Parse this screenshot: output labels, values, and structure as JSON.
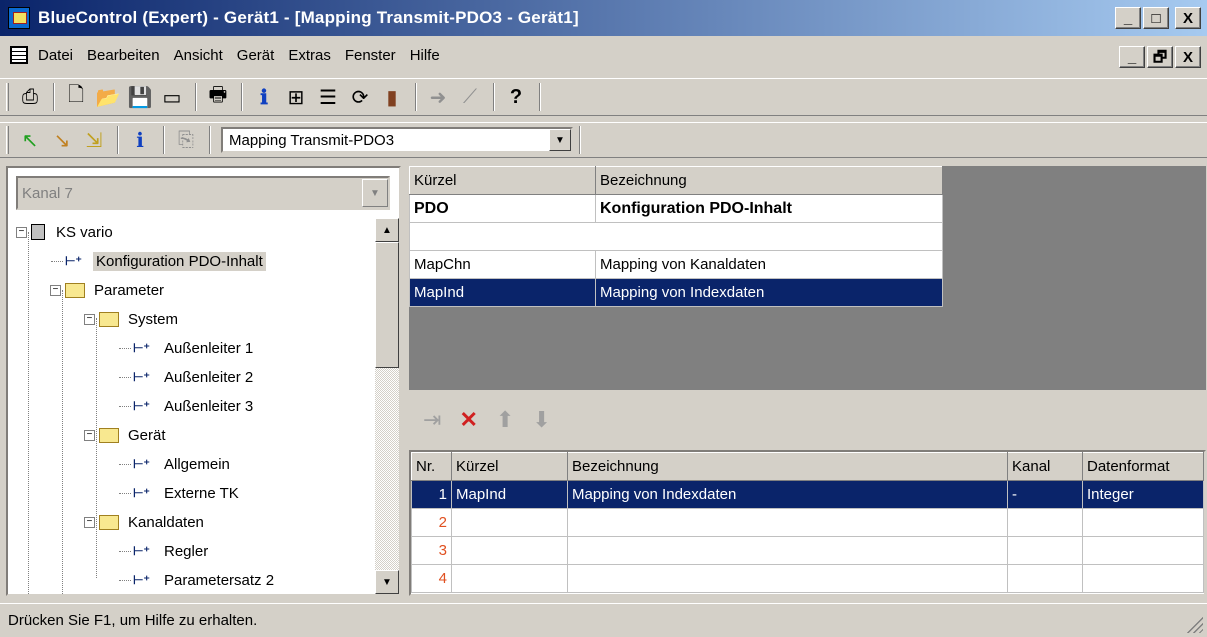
{
  "window": {
    "title": "BlueControl (Expert) - Gerät1 - [Mapping Transmit-PDO3 - Gerät1]",
    "buttons": [
      "_",
      "□",
      "X"
    ],
    "mdi_buttons": [
      "_",
      "🗗",
      "X"
    ]
  },
  "menu": {
    "items": [
      "Datei",
      "Bearbeiten",
      "Ansicht",
      "Gerät",
      "Extras",
      "Fenster",
      "Hilfe"
    ]
  },
  "toolbar1": {
    "icons": [
      "properties-icon",
      "new-icon",
      "open-icon",
      "save-icon",
      "window-icon",
      "print-icon",
      "info-icon",
      "tree-icon",
      "list-icon",
      "refresh-icon",
      "device-icon",
      "transfer-icon",
      "chart-icon",
      "help-icon"
    ],
    "glyphs": [
      "⎙",
      "🗋",
      "📂",
      "💾",
      "▭",
      "🖶",
      "ℹ",
      "⊞",
      "☰",
      "⟳",
      "▮",
      "➜",
      "⟋",
      "?"
    ]
  },
  "toolbar2": {
    "glyphs": [
      "↖",
      "↘",
      "⇲",
      "ℹ",
      "⎘"
    ],
    "combo_value": "Mapping Transmit-PDO3"
  },
  "left": {
    "kanal": "Kanal 7",
    "tree": [
      {
        "label": "KS vario",
        "type": "device",
        "level": 0,
        "expander": "−"
      },
      {
        "label": "Konfiguration PDO-Inhalt",
        "type": "param",
        "level": 1,
        "selected": true
      },
      {
        "label": "Parameter",
        "type": "folder",
        "level": 1,
        "expander": "−"
      },
      {
        "label": "System",
        "type": "folder",
        "level": 2,
        "expander": "−"
      },
      {
        "label": "Außenleiter 1",
        "type": "param",
        "level": 3
      },
      {
        "label": "Außenleiter 2",
        "type": "param",
        "level": 3
      },
      {
        "label": "Außenleiter 3",
        "type": "param",
        "level": 3
      },
      {
        "label": "Gerät",
        "type": "folder",
        "level": 2,
        "expander": "−"
      },
      {
        "label": "Allgemein",
        "type": "param",
        "level": 3
      },
      {
        "label": "Externe TK",
        "type": "param",
        "level": 3
      },
      {
        "label": "Kanaldaten",
        "type": "folder",
        "level": 2,
        "expander": "−"
      },
      {
        "label": "Regler",
        "type": "param",
        "level": 3
      },
      {
        "label": "Parametersatz 2",
        "type": "param",
        "level": 3
      }
    ]
  },
  "upper_table": {
    "headers": [
      "Kürzel",
      "Bezeichnung"
    ],
    "title_row": [
      "PDO",
      "Konfiguration PDO-Inhalt"
    ],
    "rows": [
      [
        "MapChn",
        "Mapping von Kanaldaten"
      ],
      [
        "MapInd",
        "Mapping von Indexdaten"
      ]
    ]
  },
  "lower_table": {
    "headers": [
      "Nr.",
      "Kürzel",
      "Bezeichnung",
      "Kanal",
      "Datenformat"
    ],
    "rows": [
      [
        "1",
        "MapInd",
        "Mapping von Indexdaten",
        "-",
        "Integer"
      ],
      [
        "2",
        "",
        "",
        "",
        ""
      ],
      [
        "3",
        "",
        "",
        "",
        ""
      ],
      [
        "4",
        "",
        "",
        "",
        ""
      ]
    ]
  },
  "status": {
    "text": "Drücken Sie F1, um Hilfe zu erhalten."
  }
}
